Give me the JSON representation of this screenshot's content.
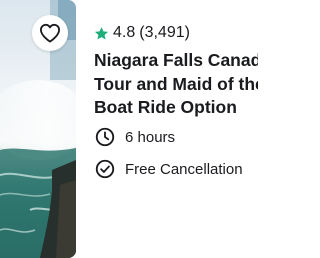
{
  "card": {
    "wishlist_icon": "heart-outline-icon",
    "rating": {
      "star_icon": "star-icon",
      "star_color": "#1eae79",
      "score": "4.8",
      "count": "(3,491)"
    },
    "title_lines": [
      "Niagara Falls Canadi",
      "Tour and Maid of the",
      "Boat Ride Option"
    ],
    "features": [
      {
        "icon": "clock-icon",
        "label": "6 hours"
      },
      {
        "icon": "check-circle-icon",
        "label": "Free Cancellation"
      }
    ]
  }
}
